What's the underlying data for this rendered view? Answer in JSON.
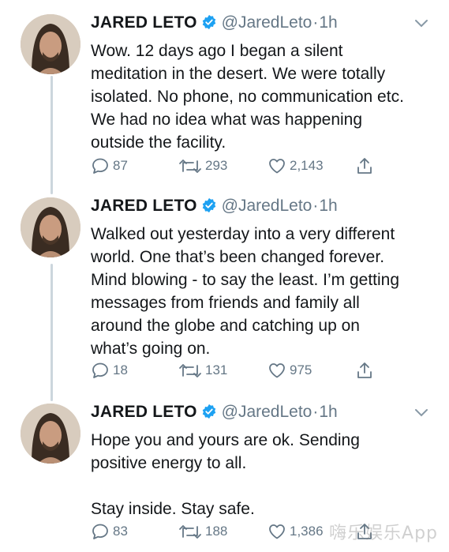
{
  "tweets": [
    {
      "name": "JARED LETO",
      "handle": "@JaredLeto",
      "separator": "·",
      "time": "1h",
      "text": "Wow. 12 days ago I began a silent\nmeditation in the desert. We were totally\nisolated. No phone, no communication etc.\nWe had no idea what was happening\noutside the facility.",
      "replies": "87",
      "retweets": "293",
      "likes": "2,143"
    },
    {
      "name": "JARED LETO",
      "handle": "@JaredLeto",
      "separator": "·",
      "time": "1h",
      "text": "Walked out yesterday into a very different\nworld. One that’s been changed forever.\nMind blowing - to say the least. I’m getting\nmessages from friends and family all\naround the globe and catching up on\nwhat’s going on.",
      "replies": "18",
      "retweets": "131",
      "likes": "975"
    },
    {
      "name": "JARED LETO",
      "handle": "@JaredLeto",
      "separator": "·",
      "time": "1h",
      "text": "Hope you and yours are ok. Sending\npositive energy to all.\n\nStay inside. Stay safe.",
      "replies": "83",
      "retweets": "188",
      "likes": "1,386"
    }
  ],
  "watermark": "嗨乐娱乐App",
  "colors": {
    "verified": "#1da1f2",
    "secondary_text": "#657786",
    "thread_line": "#ccd6dd"
  }
}
